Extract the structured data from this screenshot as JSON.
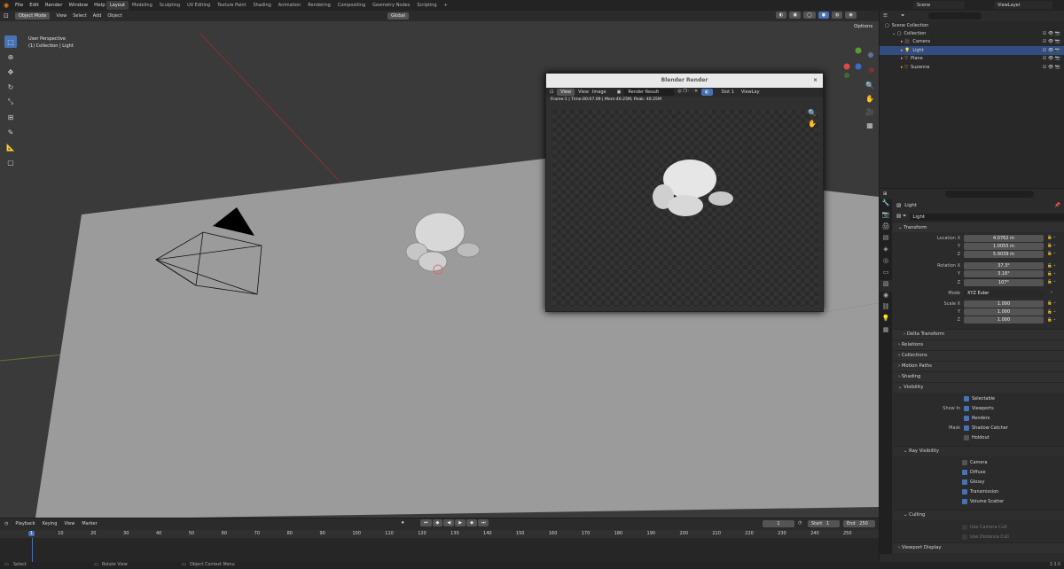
{
  "topbar": {
    "menus": [
      "File",
      "Edit",
      "Render",
      "Window",
      "Help"
    ],
    "workspaces": [
      "Layout",
      "Modeling",
      "Sculpting",
      "UV Editing",
      "Texture Paint",
      "Shading",
      "Animation",
      "Rendering",
      "Compositing",
      "Geometry Nodes",
      "Scripting",
      "+"
    ],
    "active_workspace": "Layout",
    "scene": "Scene",
    "view_layer": "ViewLayer"
  },
  "viewport": {
    "mode": "Object Mode",
    "menus": [
      "View",
      "Select",
      "Add",
      "Object"
    ],
    "transform_orientation": "Global",
    "options_label": "Options",
    "overlay_line1": "User Perspective",
    "overlay_line2": "(1) Collection | Light"
  },
  "render_window": {
    "title": "Blender Render",
    "menus": [
      "View",
      "View",
      "Image"
    ],
    "image_name": "Render Result",
    "slot": "Slot 1",
    "view_layer": "ViewLay",
    "info": "Frame:1 | Time:00:07.09 | Mem:40.25M, Peak: 40.25M"
  },
  "outliner": {
    "root": "Scene Collection",
    "items": [
      {
        "label": "Collection",
        "level": 0
      },
      {
        "label": "Camera",
        "level": 1
      },
      {
        "label": "Light",
        "level": 1,
        "selected": true
      },
      {
        "label": "Plane",
        "level": 1
      },
      {
        "label": "Suzanne",
        "level": 1
      }
    ]
  },
  "properties": {
    "object_name": "Light",
    "data_name": "Light",
    "transform_label": "Transform",
    "location": {
      "label": "Location X",
      "x": "4.0762 m",
      "y": "1.0055 m",
      "z": "5.9039 m"
    },
    "rotation": {
      "label": "Rotation X",
      "x": "37.3°",
      "y": "3.16°",
      "z": "107°"
    },
    "mode_label": "Mode",
    "mode": "XYZ Euler",
    "scale": {
      "label": "Scale X",
      "x": "1.000",
      "y": "1.000",
      "z": "1.000"
    },
    "axis_y": "Y",
    "axis_z": "Z",
    "sections": [
      "Delta Transform",
      "Relations",
      "Collections",
      "Motion Paths",
      "Shading",
      "Visibility"
    ],
    "visibility": {
      "selectable": "Selectable",
      "show_in": "Show In",
      "viewports": "Viewports",
      "renders": "Renders",
      "mask": "Mask",
      "shadow_catcher": "Shadow Catcher",
      "holdout": "Holdout"
    },
    "ray_visibility_label": "Ray Visibility",
    "ray_visibility": [
      "Camera",
      "Diffuse",
      "Glossy",
      "Transmission",
      "Volume Scatter"
    ],
    "culling_label": "Culling",
    "culling": [
      "Use Camera Cull",
      "Use Distance Cull"
    ],
    "viewport_display": "Viewport Display"
  },
  "timeline": {
    "menus": [
      "Playback",
      "Keying",
      "View",
      "Marker"
    ],
    "current_frame": "1",
    "start_label": "Start",
    "start": "1",
    "end_label": "End",
    "end": "250",
    "ticks": [
      "1",
      "10",
      "20",
      "30",
      "40",
      "50",
      "60",
      "70",
      "80",
      "90",
      "100",
      "110",
      "120",
      "130",
      "140",
      "150",
      "160",
      "170",
      "180",
      "190",
      "200",
      "210",
      "220",
      "230",
      "240",
      "250"
    ]
  },
  "statusbar": {
    "select": "Select",
    "rotate": "Rotate View",
    "context": "Object Context Menu",
    "version": "3.3.0"
  },
  "colors": {
    "accent": "#4772b3",
    "selected_row": "#334d80"
  }
}
